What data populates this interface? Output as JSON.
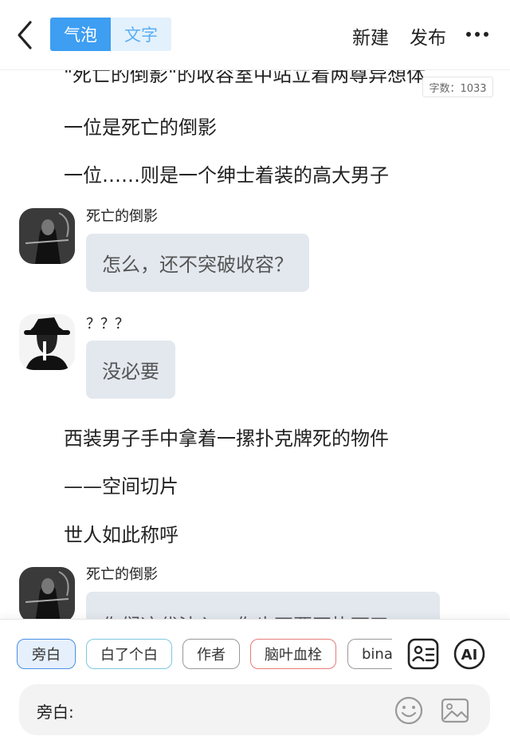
{
  "header": {
    "mode_bubble": "气泡",
    "mode_text": "文字",
    "new_label": "新建",
    "publish_label": "发布",
    "accent_color": "#3d9ef2"
  },
  "word_count": "字数：1033",
  "story": {
    "narration": [
      "\"死亡的倒影\"的收容室中站立着两尊异想体",
      "一位是死亡的倒影",
      "一位……则是一个绅士着装的高大男子",
      "西装男子手中拿着一摞扑克牌死的物件",
      "——空间切片",
      "世人如此称呼"
    ],
    "dialogues": [
      {
        "speaker": "死亡的倒影",
        "text": "怎么，还不突破收容？",
        "avatar": "reaper-avatar"
      },
      {
        "speaker": "？？？",
        "text": "没必要",
        "avatar": "gentleman-hat-avatar"
      },
      {
        "speaker": "死亡的倒影",
        "text": "你们这代法入，你也不要再执帀了",
        "avatar": "reaper-avatar"
      }
    ]
  },
  "chips": [
    "旁白",
    "白了个白",
    "作者",
    "脑叶血栓",
    "bina"
  ],
  "input": {
    "prefix": "旁白:"
  },
  "icons": [
    "back-arrow-icon",
    "more-icon",
    "character-card-icon",
    "ai-icon",
    "emoji-icon",
    "image-icon"
  ]
}
